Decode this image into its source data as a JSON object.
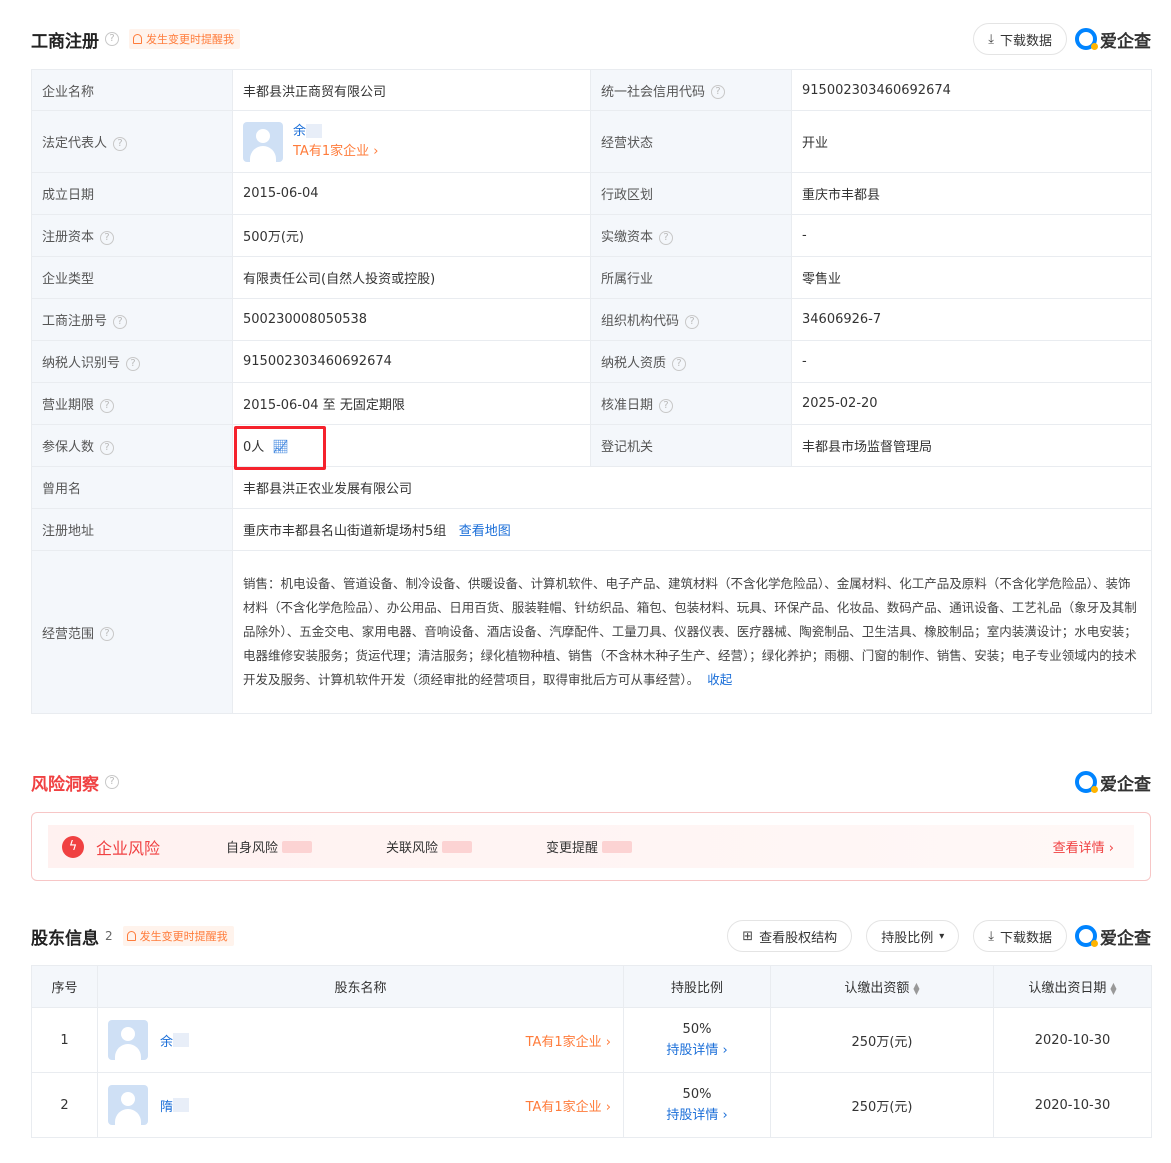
{
  "gs": {
    "title": "工商注册",
    "remind": "发生变更时提醒我",
    "download": "下载数据",
    "logo": "爱企查",
    "rows": {
      "company_name_k": "企业名称",
      "company_name_v": "丰都县洪正商贸有限公司",
      "credit_code_k": "统一社会信用代码",
      "credit_code_v": "915002303460692674",
      "legal_rep_k": "法定代表人",
      "legal_rep_name": "余",
      "legal_rep_link": "TA有1家企业 ›",
      "status_k": "经营状态",
      "status_v": "开业",
      "found_k": "成立日期",
      "found_v": "2015-06-04",
      "region_k": "行政区划",
      "region_v": "重庆市丰都县",
      "reg_cap_k": "注册资本",
      "reg_cap_v": "500万(元)",
      "paid_cap_k": "实缴资本",
      "paid_cap_v": "-",
      "type_k": "企业类型",
      "type_v": "有限责任公司(自然人投资或控股)",
      "industry_k": "所属行业",
      "industry_v": "零售业",
      "reg_no_k": "工商注册号",
      "reg_no_v": "500230008050538",
      "org_code_k": "组织机构代码",
      "org_code_v": "34606926-7",
      "tax_id_k": "纳税人识别号",
      "tax_id_v": "915002303460692674",
      "tax_q_k": "纳税人资质",
      "tax_q_v": "-",
      "term_k": "营业期限",
      "term_v": "2015-06-04 至 无固定期限",
      "approve_k": "核准日期",
      "approve_v": "2025-02-20",
      "insured_k": "参保人数",
      "insured_v": "0人",
      "authority_k": "登记机关",
      "authority_v": "丰都县市场监督管理局",
      "former_k": "曾用名",
      "former_v": "丰都县洪正农业发展有限公司",
      "address_k": "注册地址",
      "address_v": "重庆市丰都县名山街道新堤场村5组",
      "address_link": "查看地图",
      "scope_k": "经营范围",
      "scope_v": "销售：机电设备、管道设备、制冷设备、供暖设备、计算机软件、电子产品、建筑材料（不含化学危险品）、金属材料、化工产品及原料（不含化学危险品）、装饰材料（不含化学危险品）、办公用品、日用百货、服装鞋帽、针纺织品、箱包、包装材料、玩具、环保产品、化妆品、数码产品、通讯设备、工艺礼品（象牙及其制品除外）、五金交电、家用电器、音响设备、酒店设备、汽摩配件、工量刀具、仪器仪表、医疗器械、陶瓷制品、卫生洁具、橡胶制品；室内装潢设计；水电安装；电器维修安装服务；货运代理；清洁服务；绿化植物种植、销售（不含林木种子生产、经营）；绿化养护；雨棚、门窗的制作、销售、安装；电子专业领域内的技术开发及服务、计算机软件开发（须经审批的经营项目，取得审批后方可从事经营）。",
      "scope_link": "收起"
    }
  },
  "risk": {
    "title": "风险洞察",
    "logo": "爱企查",
    "label": "企业风险",
    "items": [
      "自身风险",
      "关联风险",
      "变更提醒"
    ],
    "more": "查看详情 ›"
  },
  "sh": {
    "title": "股东信息",
    "count": "2",
    "remind": "发生变更时提醒我",
    "btn_structure": "查看股权结构",
    "btn_ratio": "持股比例",
    "download": "下载数据",
    "logo": "爱企查",
    "headers": [
      "序号",
      "股东名称",
      "持股比例",
      "认缴出资额",
      "认缴出资日期"
    ],
    "rows": [
      {
        "no": "1",
        "name": "余",
        "link": "TA有1家企业 ›",
        "ratio": "50%",
        "detail": "持股详情 ›",
        "amount": "250万(元)",
        "date": "2020-10-30"
      },
      {
        "no": "2",
        "name": "隋",
        "link": "TA有1家企业 ›",
        "ratio": "50%",
        "detail": "持股详情 ›",
        "amount": "250万(元)",
        "date": "2020-10-30"
      }
    ]
  }
}
